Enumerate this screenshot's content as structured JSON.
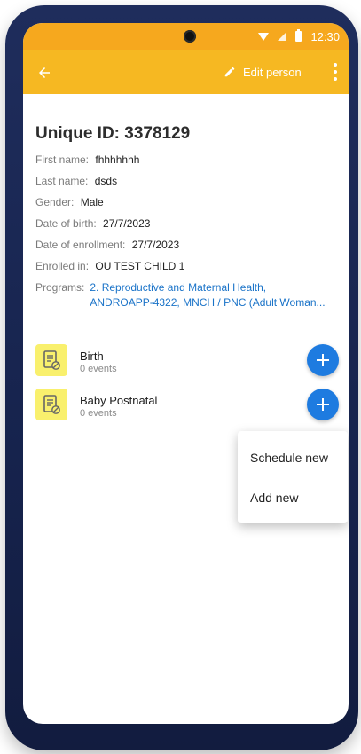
{
  "status": {
    "time": "12:30"
  },
  "appbar": {
    "edit_label": "Edit person"
  },
  "person": {
    "unique_id_label": "Unique ID: 3378129",
    "first_name_label": "First name:",
    "first_name_value": "fhhhhhhh",
    "last_name_label": "Last name:",
    "last_name_value": "dsds",
    "gender_label": "Gender:",
    "gender_value": "Male",
    "dob_label": "Date of birth:",
    "dob_value": "27/7/2023",
    "enrollment_label": "Date of enrollment:",
    "enrollment_value": "27/7/2023",
    "enrolled_in_label": "Enrolled in:",
    "enrolled_in_value": "OU TEST CHILD 1",
    "programs_label": "Programs:",
    "programs_value_line1": "2. Reproductive and Maternal Health,",
    "programs_value_line2": "ANDROAPP-4322, MNCH / PNC (Adult Woman..."
  },
  "stages": [
    {
      "title": "Birth",
      "subtitle": "0 events"
    },
    {
      "title": "Baby Postnatal",
      "subtitle": "0 events"
    }
  ],
  "menu": {
    "items": [
      "Schedule new",
      "Add new"
    ]
  },
  "colors": {
    "status_bar": "#f6a81e",
    "app_bar": "#f6b822",
    "fab": "#1e7be0",
    "stage_icon_bg": "#f9f06d",
    "link": "#1a73c8"
  },
  "icons": {
    "back": "arrow-left",
    "edit": "pencil",
    "more": "vertical-dots",
    "stage": "document-with-block",
    "add": "plus"
  }
}
